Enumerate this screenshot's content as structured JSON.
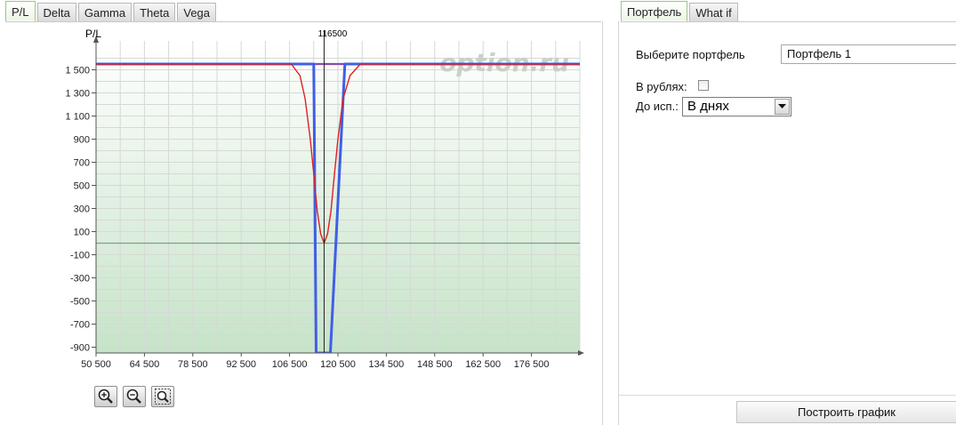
{
  "left_tabs": [
    {
      "label": "P/L",
      "active": true
    },
    {
      "label": "Delta",
      "active": false
    },
    {
      "label": "Gamma",
      "active": false
    },
    {
      "label": "Theta",
      "active": false
    },
    {
      "label": "Vega",
      "active": false
    }
  ],
  "right_tabs": [
    {
      "label": "Портфель",
      "active": true
    },
    {
      "label": "What if",
      "active": false
    }
  ],
  "colors": {
    "expiry_line": "#3f5fe6",
    "current_line": "#e02020",
    "profit_line": "#8a4aa8",
    "zero_line": "#8a9a8a",
    "watermark": "#c9d0c9"
  },
  "chart_data": {
    "type": "line",
    "ylabel": "P/L",
    "marker_label": "116500",
    "marker_x": 116500,
    "watermark": "option.ru",
    "xlim": [
      50500,
      190500
    ],
    "ylim": [
      -950,
      1750
    ],
    "x_ticks": [
      50500,
      64500,
      78500,
      92500,
      106500,
      120500,
      134500,
      148500,
      162500,
      176500
    ],
    "x_tick_labels": [
      "50 500",
      "64 500",
      "78 500",
      "92 500",
      "106 500",
      "120 500",
      "134 500",
      "148 500",
      "162 500",
      "176 500"
    ],
    "y_ticks": [
      1500,
      1300,
      1100,
      900,
      700,
      500,
      300,
      100,
      -100,
      -300,
      -500,
      -700,
      -900
    ],
    "y_tick_labels": [
      "1 500",
      "1 300",
      "1 100",
      "900",
      "700",
      "500",
      "300",
      "100",
      "-100",
      "-300",
      "-500",
      "-700",
      "-900"
    ],
    "zero_level": 0,
    "series": [
      {
        "role": "profit_level",
        "color": "#8a4aa8",
        "x": [
          50500,
          190500
        ],
        "y": [
          1550,
          1550
        ]
      },
      {
        "role": "at_expiration",
        "color": "#3f5fe6",
        "x": [
          50500,
          109500,
          113500,
          114200,
          116500,
          116700,
          118300,
          122500,
          190500
        ],
        "y": [
          1550,
          1550,
          1550,
          -950,
          -950,
          -950,
          -950,
          1550,
          1550
        ]
      },
      {
        "role": "current",
        "color": "#e02020",
        "x": [
          50500,
          107000,
          109500,
          111000,
          112500,
          113500,
          114500,
          115500,
          116500,
          117500,
          118500,
          119500,
          120500,
          122000,
          124000,
          127000,
          190500
        ],
        "y": [
          1550,
          1550,
          1450,
          1250,
          900,
          600,
          280,
          80,
          0,
          80,
          280,
          600,
          900,
          1250,
          1450,
          1550,
          1550
        ]
      }
    ]
  },
  "zoom": {
    "zoom_in_icon": "zoom-in-icon",
    "zoom_out_icon": "zoom-out-icon",
    "zoom_fit_icon": "zoom-fit-icon"
  },
  "portfolio": {
    "select_label": "Выберите портфель",
    "selected": "Портфель 1",
    "rub_label": "В рублях:",
    "rub_checked": false,
    "expiry_label": "До исп.:",
    "expiry_selected": "В днях",
    "build_button": "Построить график"
  }
}
